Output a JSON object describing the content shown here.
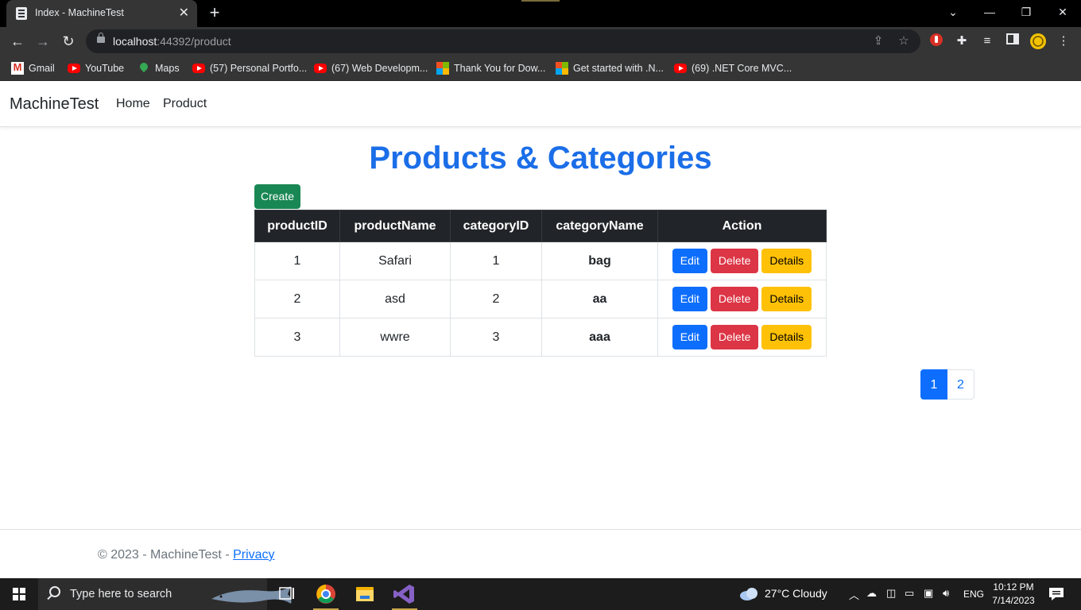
{
  "browser": {
    "tab_title": "Index - MachineTest",
    "tab_close": "✕",
    "new_tab": "+",
    "url_host": "localhost",
    "url_rest": ":44392/product",
    "window_controls": {
      "tabsearch": "⌄",
      "minimize": "—",
      "restore": "❐",
      "close": "✕"
    },
    "nav": {
      "back": "←",
      "forward": "→",
      "reload": "↻"
    },
    "bookmarks": [
      {
        "label": "Gmail",
        "icon": "gmail-icon"
      },
      {
        "label": "YouTube",
        "icon": "youtube-icon"
      },
      {
        "label": "Maps",
        "icon": "maps-icon"
      },
      {
        "label": "(57) Personal Portfo...",
        "icon": "youtube-icon"
      },
      {
        "label": "(67) Web Developm...",
        "icon": "youtube-icon"
      },
      {
        "label": "Thank You for Dow...",
        "icon": "microsoft-icon"
      },
      {
        "label": "Get started with .N...",
        "icon": "microsoft-icon"
      },
      {
        "label": "(69) .NET Core MVC...",
        "icon": "youtube-icon"
      }
    ]
  },
  "site": {
    "brand": "MachineTest",
    "nav": [
      "Home",
      "Product"
    ],
    "page_title": "Products & Categories",
    "create_label": "Create",
    "table": {
      "headers": [
        "productID",
        "productName",
        "categoryID",
        "categoryName",
        "Action"
      ],
      "rows": [
        {
          "productID": "1",
          "productName": "Safari",
          "categoryID": "1",
          "categoryName": "bag"
        },
        {
          "productID": "2",
          "productName": "asd",
          "categoryID": "2",
          "categoryName": "aa"
        },
        {
          "productID": "3",
          "productName": "wwre",
          "categoryID": "3",
          "categoryName": "aaa"
        }
      ],
      "action_labels": {
        "edit": "Edit",
        "delete": "Delete",
        "details": "Details"
      }
    },
    "pagination": {
      "pages": [
        "1",
        "2"
      ],
      "current": "1"
    },
    "footer": {
      "text": "© 2023 - MachineTest - ",
      "privacy": "Privacy"
    }
  },
  "taskbar": {
    "search_placeholder": "Type here to search",
    "weather": "27°C  Cloudy",
    "language": "ENG",
    "time": "10:12 PM",
    "date": "7/14/2023"
  },
  "colors": {
    "title_blue": "#1b6ee8",
    "primary": "#0d6efd",
    "success": "#198754",
    "danger": "#dc3545",
    "warning": "#ffc107",
    "table_header": "#212529"
  }
}
